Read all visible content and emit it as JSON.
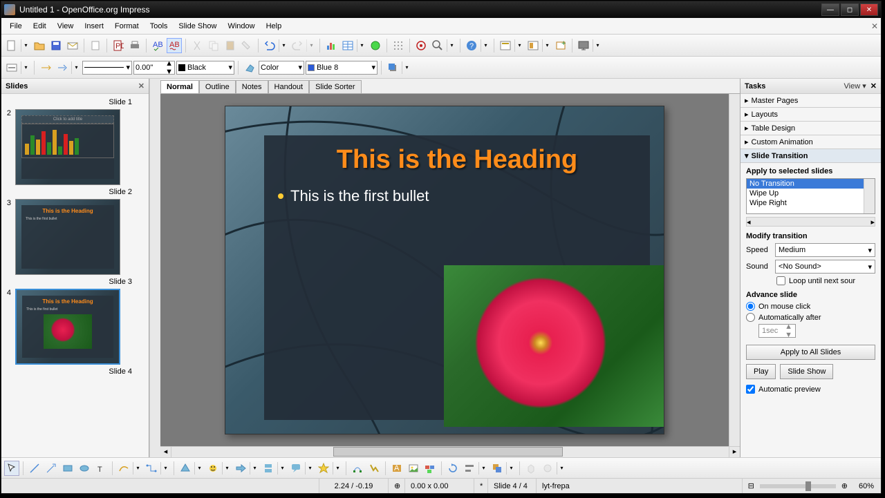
{
  "title": "Untitled 1 - OpenOffice.org Impress",
  "menus": [
    "File",
    "Edit",
    "View",
    "Insert",
    "Format",
    "Tools",
    "Slide Show",
    "Window",
    "Help"
  ],
  "toolbar2": {
    "width": "0.00\"",
    "lineColor": "Black",
    "fillMode": "Color",
    "fillColor": "Blue 8"
  },
  "slidesPanel": {
    "title": "Slides",
    "labels": [
      "Slide 1",
      "Slide 2",
      "Slide 3",
      "Slide 4"
    ],
    "thumb2_placeholder": "Click to add title",
    "thumb_heading": "This is the Heading",
    "thumb_bullet": "This is the first bullet"
  },
  "viewTabs": [
    "Normal",
    "Outline",
    "Notes",
    "Handout",
    "Slide Sorter"
  ],
  "slide": {
    "heading": "This is the Heading",
    "bullet": "This is the first bullet"
  },
  "tasks": {
    "title": "Tasks",
    "viewLabel": "View",
    "sections": [
      "Master Pages",
      "Layouts",
      "Table Design",
      "Custom Animation",
      "Slide Transition"
    ],
    "applyLabel": "Apply to selected slides",
    "transitions": [
      "No Transition",
      "Wipe Up",
      "Wipe Right"
    ],
    "modifyLabel": "Modify transition",
    "speedLabel": "Speed",
    "speedValue": "Medium",
    "soundLabel": "Sound",
    "soundValue": "<No Sound>",
    "loopLabel": "Loop until next sour",
    "advanceLabel": "Advance slide",
    "onClickLabel": "On mouse click",
    "autoLabel": "Automatically after",
    "autoValue": "1sec",
    "applyAllBtn": "Apply to All Slides",
    "playBtn": "Play",
    "slideShowBtn": "Slide Show",
    "previewLabel": "Automatic preview"
  },
  "status": {
    "coords": "2.24 / -0.19",
    "size": "0.00 x 0.00",
    "slideInfo": "Slide 4 / 4",
    "layout": "lyt-frepa",
    "zoom": "60%"
  }
}
